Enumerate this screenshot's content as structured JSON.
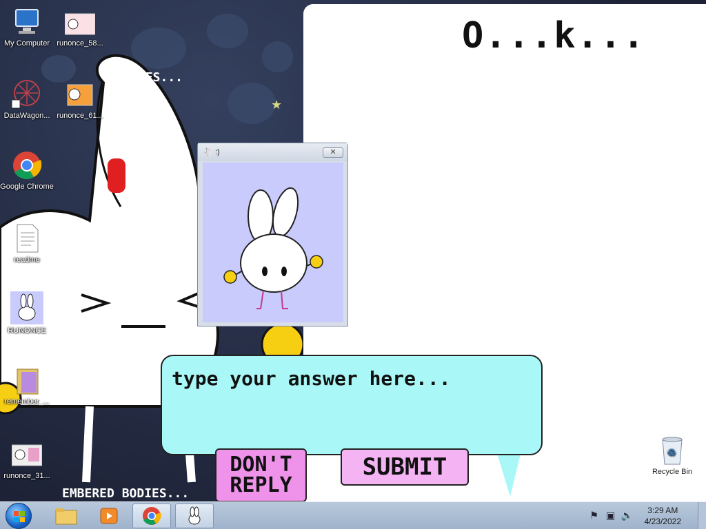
{
  "desktop": {
    "icons": [
      {
        "label": "My Computer"
      },
      {
        "label": "runonce_58..."
      },
      {
        "label": "DataWagon..."
      },
      {
        "label": "runonce_61..."
      },
      {
        "label": "Google Chrome"
      },
      {
        "label": "readme"
      },
      {
        "label": "RUNONCE"
      },
      {
        "label": "remember_..."
      },
      {
        "label": "runonce_31..."
      },
      {
        "label": "Recycle Bin"
      }
    ]
  },
  "speech": {
    "text": "O...k..."
  },
  "popup": {
    "title": ":)",
    "close": "✕"
  },
  "answer": {
    "placeholder": "type your answer here...",
    "dont_reply_line1": "DON'T",
    "dont_reply_line2": "REPLY",
    "submit": "SUBMIT"
  },
  "taskbar": {
    "clock_time": "3:29 AM",
    "clock_date": "4/23/2022"
  },
  "colors": {
    "bubble": "#aaf7f7",
    "button": "#f4b3f2",
    "popup_bg": "#c8cbfb"
  }
}
